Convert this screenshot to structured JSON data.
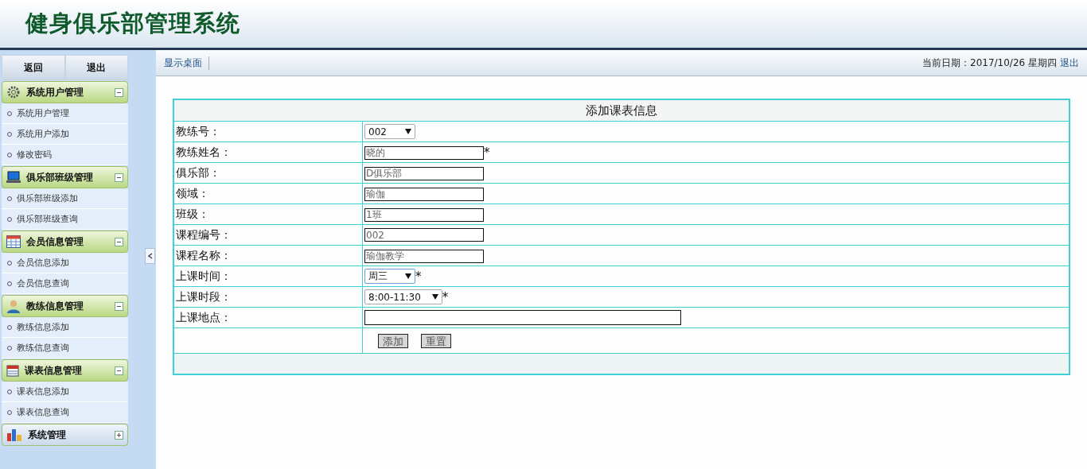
{
  "header": {
    "title": "健身俱乐部管理系统"
  },
  "sidebar": {
    "buttons": [
      "返回",
      "退出"
    ],
    "groups": [
      {
        "title": "系统用户管理",
        "expanded": true,
        "items": [
          "系统用户管理",
          "系统用户添加",
          "修改密码"
        ]
      },
      {
        "title": "俱乐部班级管理",
        "expanded": true,
        "items": [
          "俱乐部班级添加",
          "俱乐部班级查询"
        ]
      },
      {
        "title": "会员信息管理",
        "expanded": true,
        "items": [
          "会员信息添加",
          "会员信息查询"
        ]
      },
      {
        "title": "教练信息管理",
        "expanded": true,
        "items": [
          "教练信息添加",
          "教练信息查询"
        ]
      },
      {
        "title": "课表信息管理",
        "expanded": true,
        "items": [
          "课表信息添加",
          "课表信息查询"
        ]
      },
      {
        "title": "系统管理",
        "expanded": false
      }
    ]
  },
  "toolbar": {
    "link": "显示桌面",
    "date": "当前日期：2017/10/26 星期四",
    "logout": "退出"
  },
  "form": {
    "title": "添加课表信息",
    "rows": [
      {
        "label": "教练号：",
        "kind": "select",
        "value": "002"
      },
      {
        "label": "教练姓名：",
        "kind": "text",
        "value": "晓的",
        "required_mark": "*"
      },
      {
        "label": "俱乐部：",
        "kind": "text",
        "value": "D俱乐部"
      },
      {
        "label": "领域：",
        "kind": "text",
        "value": "瑜伽"
      },
      {
        "label": "班级：",
        "kind": "text",
        "value": "1班"
      },
      {
        "label": "课程编号：",
        "kind": "text",
        "value": "002"
      },
      {
        "label": "课程名称：",
        "kind": "text",
        "value": "瑜伽教学"
      },
      {
        "label": "上课时间：",
        "kind": "select",
        "value": "周三",
        "focused": true,
        "required_mark": "*"
      },
      {
        "label": "上课时段：",
        "kind": "select",
        "value": "8:00-11:30",
        "required_mark": "*"
      },
      {
        "label": "上课地点：",
        "kind": "wide"
      }
    ],
    "buttons": [
      "添加",
      "重置"
    ]
  }
}
